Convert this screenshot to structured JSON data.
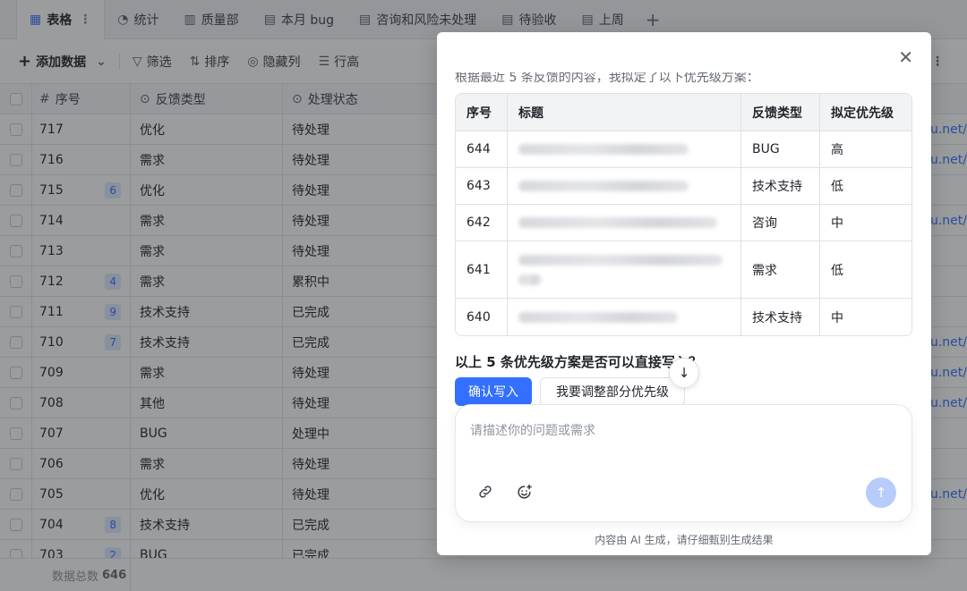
{
  "tabs": [
    {
      "label": "表格",
      "icon": "grid-icon",
      "active": true
    },
    {
      "label": "统计",
      "icon": "chart-icon"
    },
    {
      "label": "质量部",
      "icon": "board-icon"
    },
    {
      "label": "本月 bug",
      "icon": "table-icon"
    },
    {
      "label": "咨询和风险未处理",
      "icon": "table-icon"
    },
    {
      "label": "待验收",
      "icon": "table-icon"
    },
    {
      "label": "上周",
      "icon": "table-icon"
    }
  ],
  "toolbar": {
    "add_label": "添加数据",
    "filter_label": "筛选",
    "sort_label": "排序",
    "hide_label": "隐藏列",
    "row_height_label": "行高"
  },
  "grid": {
    "headers": {
      "id": "序号",
      "type": "反馈类型",
      "status": "处理状态"
    },
    "rows": [
      {
        "id": "717",
        "badge": "",
        "type": "优化",
        "status": "待处理",
        "link": "u.net/"
      },
      {
        "id": "716",
        "badge": "",
        "type": "需求",
        "status": "待处理",
        "link": "u.net/"
      },
      {
        "id": "715",
        "badge": "6",
        "type": "优化",
        "status": "待处理",
        "link": ""
      },
      {
        "id": "714",
        "badge": "",
        "type": "需求",
        "status": "待处理",
        "link": "u.net/"
      },
      {
        "id": "713",
        "badge": "",
        "type": "需求",
        "status": "待处理",
        "link": ""
      },
      {
        "id": "712",
        "badge": "4",
        "type": "需求",
        "status": "累积中",
        "link": ""
      },
      {
        "id": "711",
        "badge": "9",
        "type": "技术支持",
        "status": "已完成",
        "link": ""
      },
      {
        "id": "710",
        "badge": "7",
        "type": "技术支持",
        "status": "已完成",
        "link": "u.net/"
      },
      {
        "id": "709",
        "badge": "",
        "type": "需求",
        "status": "待处理",
        "link": "u.net/"
      },
      {
        "id": "708",
        "badge": "",
        "type": "其他",
        "status": "待处理",
        "link": "u.net/"
      },
      {
        "id": "707",
        "badge": "",
        "type": "BUG",
        "status": "处理中",
        "link": ""
      },
      {
        "id": "706",
        "badge": "",
        "type": "需求",
        "status": "待处理",
        "link": ""
      },
      {
        "id": "705",
        "badge": "",
        "type": "优化",
        "status": "待处理",
        "link": "u.net/"
      },
      {
        "id": "704",
        "badge": "8",
        "type": "技术支持",
        "status": "已完成",
        "link": ""
      },
      {
        "id": "703",
        "badge": "2",
        "type": "BUG",
        "status": "已完成",
        "link": ""
      }
    ]
  },
  "footer": {
    "label": "数据总数",
    "count": "646"
  },
  "dialog": {
    "intro": "根据最近 5 条反馈的内容，我拟定了以下优先级方案：",
    "table": {
      "headers": [
        "序号",
        "标题",
        "反馈类型",
        "拟定优先级"
      ],
      "rows": [
        {
          "id": "644",
          "type": "BUG",
          "priority": "高"
        },
        {
          "id": "643",
          "type": "技术支持",
          "priority": "低"
        },
        {
          "id": "642",
          "type": "咨询",
          "priority": "中"
        },
        {
          "id": "641",
          "type": "需求",
          "priority": "低"
        },
        {
          "id": "640",
          "type": "技术支持",
          "priority": "中"
        }
      ]
    },
    "question": "以上 5 条优先级方案是否可以直接写入？",
    "confirm_label": "确认写入",
    "adjust_label": "我要调整部分优先级",
    "input_placeholder": "请描述你的问题或需求",
    "disclaimer": "内容由 AI 生成，请仔细甄别生成结果"
  }
}
